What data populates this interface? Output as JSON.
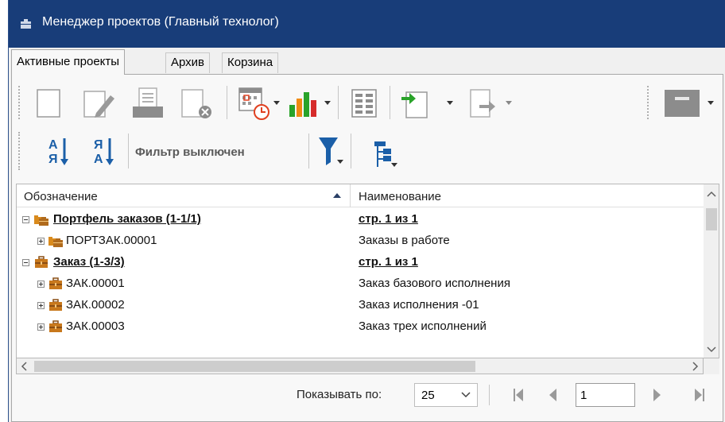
{
  "window": {
    "title": "Менеджер проектов (Главный технолог)",
    "title_icon": "window-menu-icon"
  },
  "tabs": [
    {
      "label": "Активные проекты",
      "active": true
    },
    {
      "label": "Архив",
      "active": false
    },
    {
      "label": "Корзина",
      "active": false
    }
  ],
  "toolbar": {
    "filter_status": "Фильтр выключен",
    "icons": [
      "new-document-icon",
      "edit-document-icon",
      "open-document-icon",
      "delete-document-icon",
      "schedule-calendar-icon",
      "bar-chart-icon",
      "grid-view-icon",
      "import-icon",
      "export-icon",
      "archive-box-icon",
      "sort-ascending-icon",
      "sort-descending-icon",
      "filter-funnel-icon",
      "tree-hierarchy-icon"
    ]
  },
  "grid": {
    "columns": [
      "Обозначение",
      "Наименование"
    ],
    "rows": [
      {
        "type": "group",
        "code": "Портфель заказов (1-1/1)",
        "name": "стр. 1 из 1",
        "icon": "portfolio-folder-icon"
      },
      {
        "type": "item",
        "code": "ПОРТЗАК.00001",
        "name": "Заказы в работе",
        "icon": "portfolio-folder-icon"
      },
      {
        "type": "group",
        "code": "Заказ (1-3/3)",
        "name": "стр. 1 из 1",
        "icon": "briefcase-icon"
      },
      {
        "type": "item",
        "code": "ЗАК.00001",
        "name": "Заказ базового исполнения",
        "icon": "briefcase-icon"
      },
      {
        "type": "item",
        "code": "ЗАК.00002",
        "name": "Заказ исполнения -01",
        "icon": "briefcase-icon"
      },
      {
        "type": "item",
        "code": "ЗАК.00003",
        "name": "Заказ трех исполнений",
        "icon": "briefcase-icon"
      }
    ]
  },
  "pager": {
    "label": "Показывать по:",
    "page_size": "25",
    "current_page": "1"
  },
  "colors": {
    "titlebar": "#183d79",
    "accent_green": "#2aa32a",
    "accent_blue": "#1b5fa8",
    "chart_orange": "#f08a12",
    "chart_red": "#d62b2b"
  }
}
